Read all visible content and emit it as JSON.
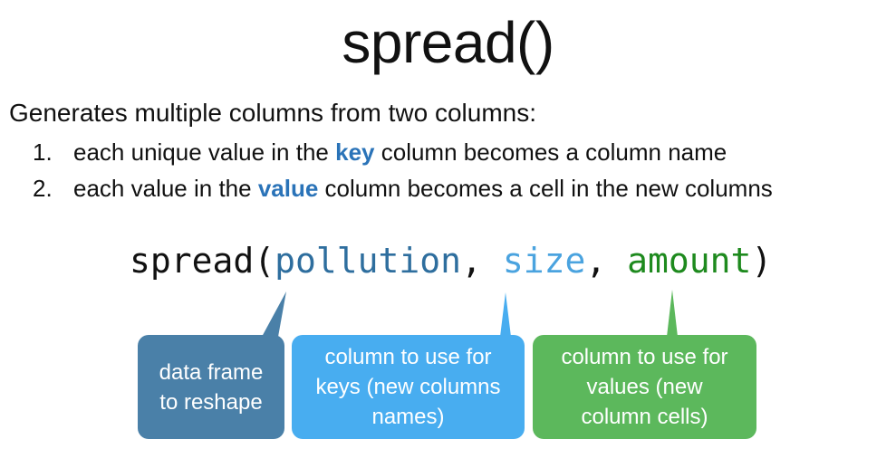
{
  "title": "spread()",
  "intro": "Generates multiple columns from two columns:",
  "steps": [
    {
      "num": "1.",
      "before": "each unique value in the ",
      "keyword": "key",
      "after": " column becomes a column name"
    },
    {
      "num": "2.",
      "before": "each value in the ",
      "keyword": "value",
      "after": " column becomes a cell in the new columns"
    }
  ],
  "code": {
    "fn": "spread(",
    "arg_df": "pollution",
    "sep1": ", ",
    "arg_key": "size",
    "sep2": ", ",
    "arg_value": "amount",
    "close": ")"
  },
  "callouts": {
    "data_frame": [
      "data frame",
      "to reshape"
    ],
    "key": [
      "column to use for",
      "keys (new columns",
      "names)"
    ],
    "value": [
      "column to use for",
      "values (new",
      "column cells)"
    ]
  },
  "colors": {
    "keyword": "#2a73b8",
    "data_frame": "#4a80a8",
    "key": "#48adf0",
    "value": "#5cb85c",
    "value_code": "#1e8a1e"
  }
}
